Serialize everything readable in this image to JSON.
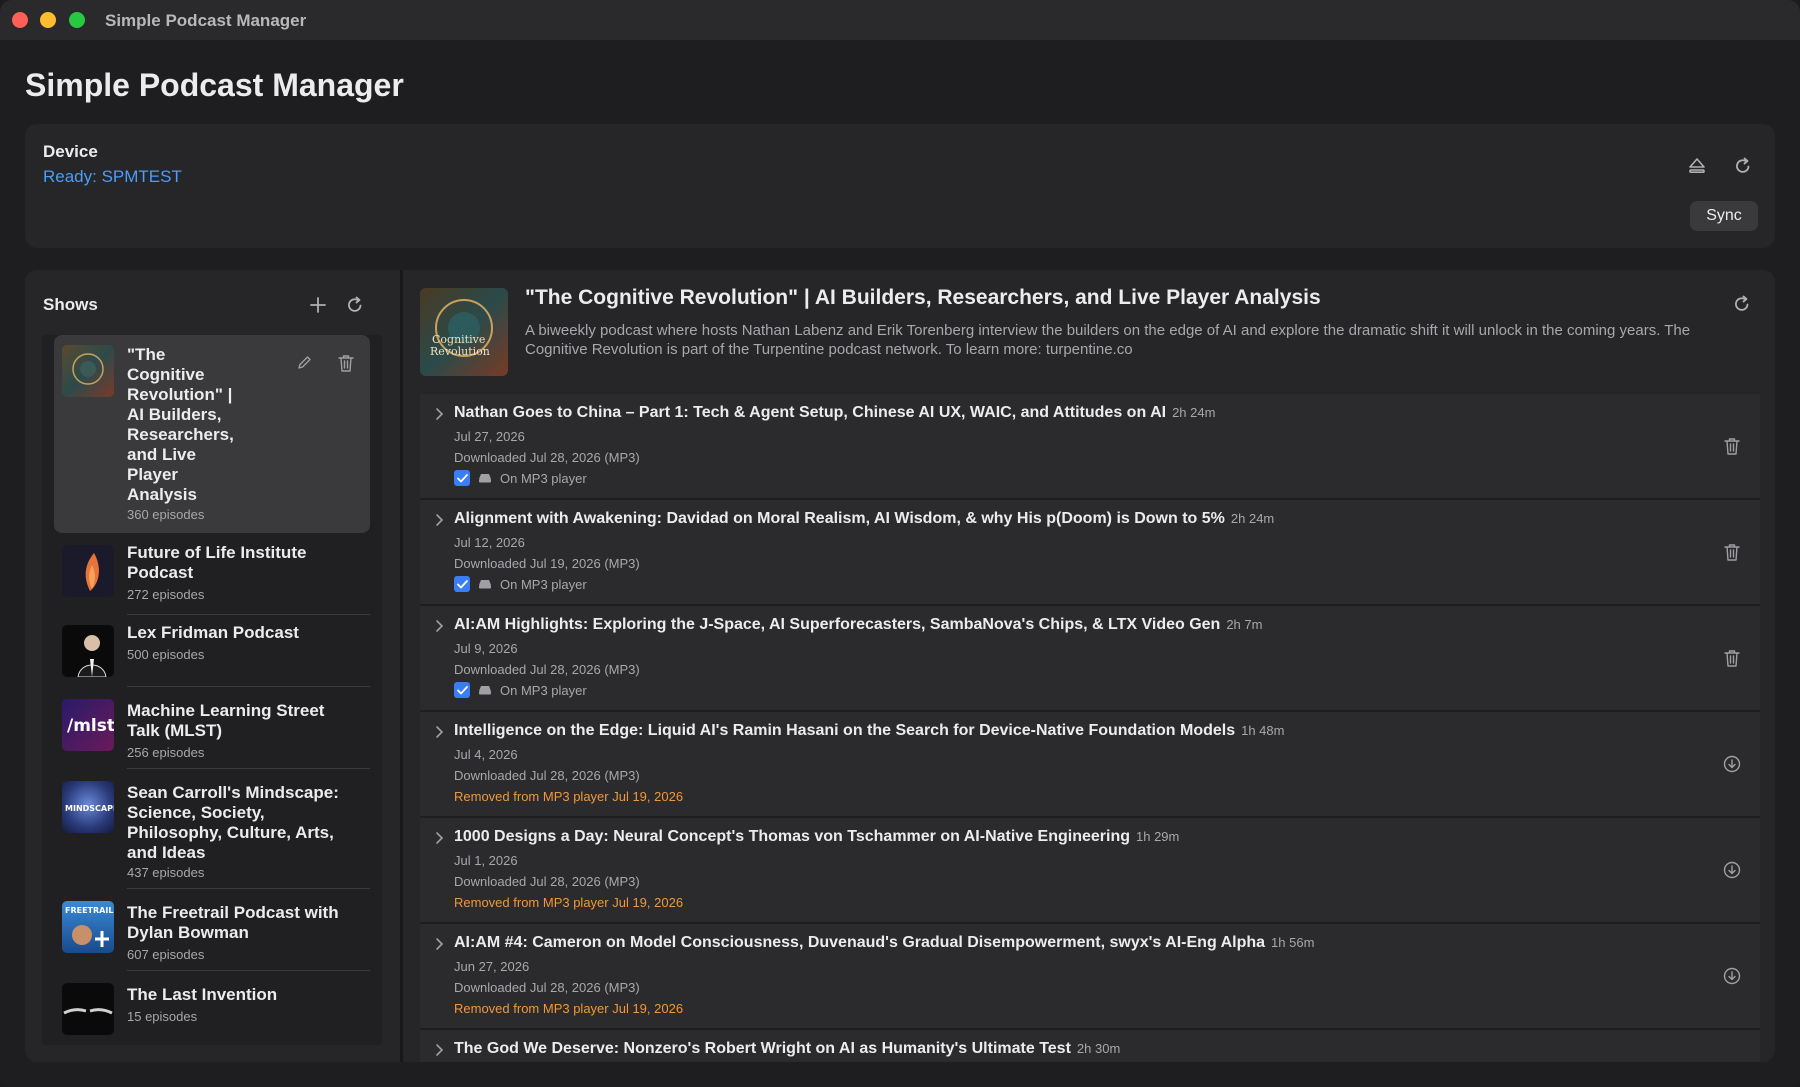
{
  "window": {
    "title": "Simple Podcast Manager"
  },
  "app": {
    "title": "Simple Podcast Manager"
  },
  "device": {
    "label": "Device",
    "status": "Ready: SPMTEST",
    "sync_label": "Sync"
  },
  "sidebar": {
    "title": "Shows",
    "shows": [
      {
        "name": "\"The Cognitive Revolution\" | AI Builders, Researchers, and Live Player Analysis",
        "episodes": "360 episodes",
        "selected": true,
        "art_label": "Cognitive Revolution"
      },
      {
        "name": "Future of Life Institute Podcast",
        "episodes": "272 episodes",
        "art_label": "Future of Life Institute Podcast"
      },
      {
        "name": "Lex Fridman Podcast",
        "episodes": "500 episodes",
        "art_label": "Lex Fridman Podcast"
      },
      {
        "name": "Machine Learning Street Talk (MLST)",
        "episodes": "256 episodes",
        "art_label": "/mlst"
      },
      {
        "name": "Sean Carroll's Mindscape: Science, Society, Philosophy, Culture, Arts, and Ideas",
        "episodes": "437 episodes",
        "art_label": "MINDSCAPE"
      },
      {
        "name": "The Freetrail Podcast with Dylan Bowman",
        "episodes": "607 episodes",
        "art_label": "FREETRAIL PODCAST"
      },
      {
        "name": "The Last Invention",
        "episodes": "15 episodes",
        "art_label": ""
      }
    ]
  },
  "podcast": {
    "title": "\"The Cognitive Revolution\" | AI Builders, Researchers, and Live Player Analysis",
    "description": "A biweekly podcast where hosts Nathan Labenz and Erik Torenberg interview the builders on the edge of AI and explore the dramatic shift it will unlock in the coming years. The Cognitive Revolution is part of the Turpentine podcast network. To learn more: turpentine.co",
    "art_label": "Cognitive Revolution",
    "episodes": [
      {
        "title": "Nathan Goes to China – Part 1: Tech & Agent Setup, Chinese AI UX, WAIC, and Attitudes on AI",
        "duration": "2h 24m",
        "date": "Jul 27, 2026",
        "downloaded": "Downloaded Jul 28, 2026 (MP3)",
        "on_player": "On MP3 player",
        "removed": "",
        "action": "trash-icon"
      },
      {
        "title": "Alignment with Awakening: Davidad on Moral Realism, AI Wisdom, & why His p(Doom) is Down to 5%",
        "duration": "2h 24m",
        "date": "Jul 12, 2026",
        "downloaded": "Downloaded Jul 19, 2026 (MP3)",
        "on_player": "On MP3 player",
        "removed": "",
        "action": "trash-icon"
      },
      {
        "title": "AI:AM Highlights: Exploring the J-Space, AI Superforecasters, SambaNova's Chips, & LTX Video Gen",
        "duration": "2h 7m",
        "date": "Jul 9, 2026",
        "downloaded": "Downloaded Jul 28, 2026 (MP3)",
        "on_player": "On MP3 player",
        "removed": "",
        "action": "trash-icon"
      },
      {
        "title": "Intelligence on the Edge: Liquid AI's Ramin Hasani on the Search for Device-Native Foundation Models",
        "duration": "1h 48m",
        "date": "Jul 4, 2026",
        "downloaded": "Downloaded Jul 28, 2026 (MP3)",
        "on_player": "",
        "removed": "Removed from MP3 player Jul 19, 2026",
        "action": "download-icon"
      },
      {
        "title": "1000 Designs a Day: Neural Concept's Thomas von Tschammer on AI-Native Engineering",
        "duration": "1h 29m",
        "date": "Jul 1, 2026",
        "downloaded": "Downloaded Jul 28, 2026 (MP3)",
        "on_player": "",
        "removed": "Removed from MP3 player Jul 19, 2026",
        "action": "download-icon"
      },
      {
        "title": "AI:AM #4: Cameron on Model Consciousness, Duvenaud's Gradual Disempowerment, swyx's AI-Eng Alpha",
        "duration": "1h 56m",
        "date": "Jun 27, 2026",
        "downloaded": "Downloaded Jul 28, 2026 (MP3)",
        "on_player": "",
        "removed": "Removed from MP3 player Jul 19, 2026",
        "action": "download-icon"
      },
      {
        "title": "The God We Deserve: Nonzero's Robert Wright on AI as Humanity's Ultimate Test",
        "duration": "2h 30m",
        "date": "",
        "downloaded": "",
        "on_player": "",
        "removed": "",
        "action": "download-icon"
      }
    ]
  },
  "colors": {
    "accent": "#3a7ef6",
    "link": "#4d9cf6",
    "warning": "#f0973b"
  }
}
